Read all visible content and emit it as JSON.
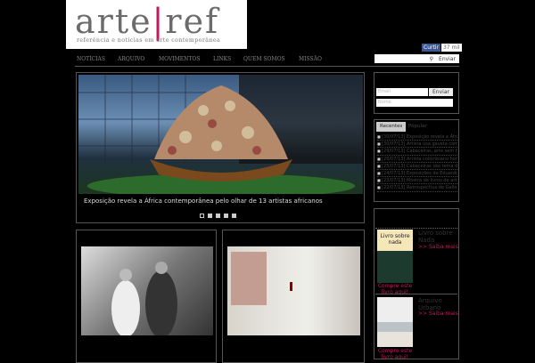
{
  "logo": {
    "word1": "arte",
    "sep": "|",
    "word2": "ref",
    "tagline": "referência e notícias em arte contemporânea"
  },
  "facebook": {
    "label": "Curtir",
    "count": "37 mil"
  },
  "nav": [
    "NOTÍCIAS",
    "ARQUIVO",
    "MOVIMENTOS",
    "LINKS",
    "QUEM SOMOS",
    "MISSÃO"
  ],
  "search": {
    "placeholder": "",
    "button": "Enviar"
  },
  "slider": {
    "caption": "Exposição revela a África contemporânea pelo olhar de 13 artistas africanos",
    "slides": 5
  },
  "newsletter": {
    "email_placeholder": "Email",
    "name_placeholder": "Nome",
    "button": "Enviar"
  },
  "tabs": {
    "active": "Recentes",
    "other": "Popular",
    "items": [
      "[30/07/13] Exposição revela a África",
      "[30/07/13] Artista usa gaveta como",
      "[29/07/13] Cabaceiras, arte sem fim",
      "[26/07/13] Artista colombiano homenageia",
      "[25/07/13] Cabaceiras são tema de",
      "[24/07/13] Exposições de Eduardo Sued",
      "[23/07/13] Mostra de livros de artista",
      "[22/07/13] Retrospectiva de Galleri"
    ]
  },
  "books": [
    {
      "title": "Livro sobre Nada",
      "cover_text": "Livro sobre nada",
      "more": ">> Saiba mais",
      "buy": "Compre este livro aqui!"
    },
    {
      "title": "Arquivo Urbano",
      "more": ">> Saiba mais",
      "buy": "Compre este livro aqui!"
    }
  ]
}
